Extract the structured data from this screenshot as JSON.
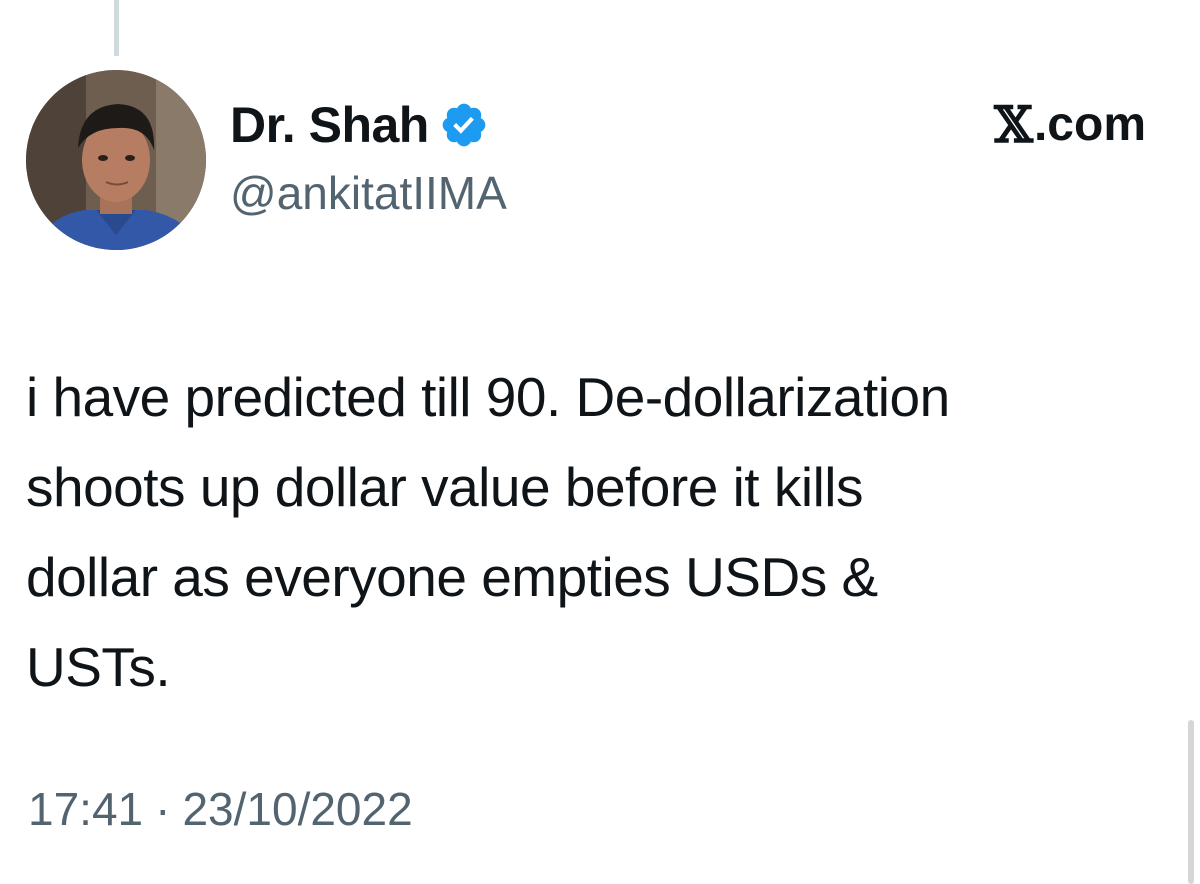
{
  "tweet": {
    "author": {
      "display_name": "Dr. Shah",
      "handle": "@ankitatIIMA",
      "verified": true,
      "verified_color": "#1d9bf0",
      "avatar_icon": "profile-photo"
    },
    "brand": {
      "x_glyph": "𝕏",
      "suffix": ".com"
    },
    "text_lines": [
      "i have predicted till 90. De-dollarization",
      "shoots up dollar value before it kills",
      "dollar as everyone empties USDs &",
      "USTs."
    ],
    "time": "17:41",
    "separator": "·",
    "date": "23/10/2022"
  },
  "colors": {
    "text_primary": "#0f1419",
    "text_secondary": "#536471",
    "thread_line": "#cfd9de"
  }
}
